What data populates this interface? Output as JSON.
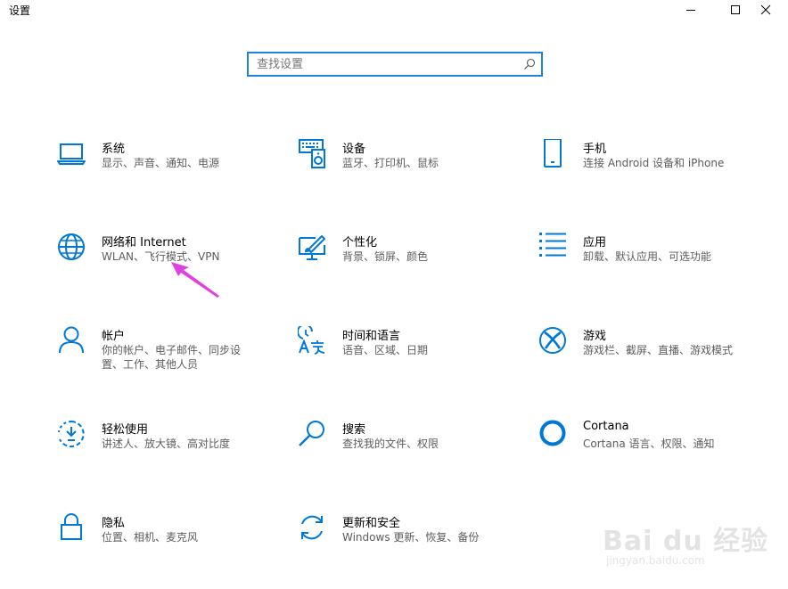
{
  "window": {
    "title": "设置"
  },
  "search": {
    "placeholder": "查找设置"
  },
  "tiles": [
    {
      "key": "system",
      "title": "系统",
      "subtitle": "显示、声音、通知、电源",
      "icon": "laptop-icon"
    },
    {
      "key": "devices",
      "title": "设备",
      "subtitle": "蓝牙、打印机、鼠标",
      "icon": "keyboard-speaker-icon"
    },
    {
      "key": "phone",
      "title": "手机",
      "subtitle": "连接 Android 设备和 iPhone",
      "icon": "phone-icon"
    },
    {
      "key": "network",
      "title": "网络和 Internet",
      "subtitle": "WLAN、飞行模式、VPN",
      "icon": "globe-icon"
    },
    {
      "key": "personalization",
      "title": "个性化",
      "subtitle": "背景、锁屏、颜色",
      "icon": "paint-monitor-icon"
    },
    {
      "key": "apps",
      "title": "应用",
      "subtitle": "卸载、默认应用、可选功能",
      "icon": "apps-list-icon"
    },
    {
      "key": "accounts",
      "title": "帐户",
      "subtitle": "你的帐户、电子邮件、同步设置、工作、其他人员",
      "icon": "person-icon"
    },
    {
      "key": "time",
      "title": "时间和语言",
      "subtitle": "语音、区域、日期",
      "icon": "time-language-icon"
    },
    {
      "key": "gaming",
      "title": "游戏",
      "subtitle": "游戏栏、截屏、直播、游戏模式",
      "icon": "xbox-icon"
    },
    {
      "key": "ease",
      "title": "轻松使用",
      "subtitle": "讲述人、放大镜、高对比度",
      "icon": "ease-of-access-icon"
    },
    {
      "key": "search",
      "title": "搜索",
      "subtitle": "查找我的文件、权限",
      "icon": "magnifier-icon"
    },
    {
      "key": "cortana",
      "title": "Cortana",
      "subtitle": "Cortana 语言、权限、通知",
      "icon": "cortana-circle-icon"
    },
    {
      "key": "privacy",
      "title": "隐私",
      "subtitle": "位置、相机、麦克风",
      "icon": "lock-icon"
    },
    {
      "key": "update",
      "title": "更新和安全",
      "subtitle": "Windows 更新、恢复、备份",
      "icon": "sync-arrows-icon"
    }
  ],
  "watermark": {
    "text": "Bai du 经验",
    "url": "jingyan.baidu.com"
  },
  "colors": {
    "accent": "#0078d7",
    "annotation_arrow": "#e040e0",
    "subtitle_text": "#5d5d5d"
  }
}
